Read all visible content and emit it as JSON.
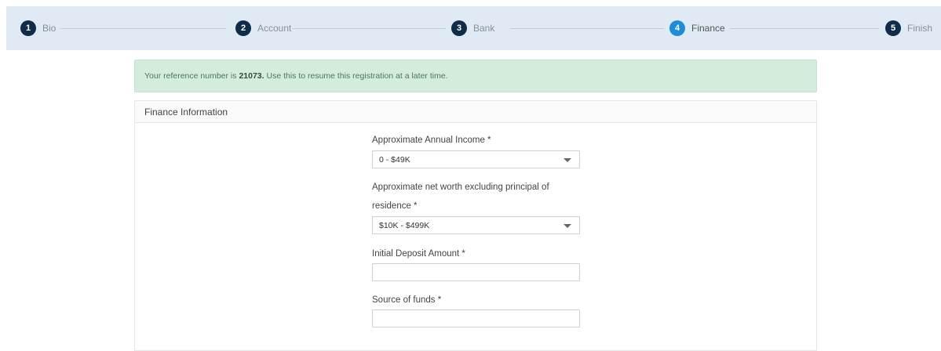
{
  "steps": [
    {
      "number": "1",
      "label": "Bio"
    },
    {
      "number": "2",
      "label": "Account"
    },
    {
      "number": "3",
      "label": "Bank"
    },
    {
      "number": "4",
      "label": "Finance"
    },
    {
      "number": "5",
      "label": "Finish"
    }
  ],
  "alert": {
    "prefix": "Your reference number is ",
    "reference": "21073.",
    "suffix": " Use this to resume this registration at a later time."
  },
  "panel": {
    "title": "Finance Information"
  },
  "form": {
    "income_label": "Approximate Annual Income *",
    "income_value": "0 - $49K",
    "networth_label_line1": "Approximate net worth excluding principal of",
    "networth_label_line2": "residence *",
    "networth_value": "$10K - $499K",
    "deposit_label": "Initial Deposit Amount *",
    "deposit_value": "",
    "source_label": "Source of funds *",
    "source_value": ""
  },
  "colors": {
    "stepper_bg": "#dfeaf4",
    "step_done": "#0f2d4a",
    "step_active": "#1f8dd6",
    "alert_bg": "#d4ecdc"
  }
}
